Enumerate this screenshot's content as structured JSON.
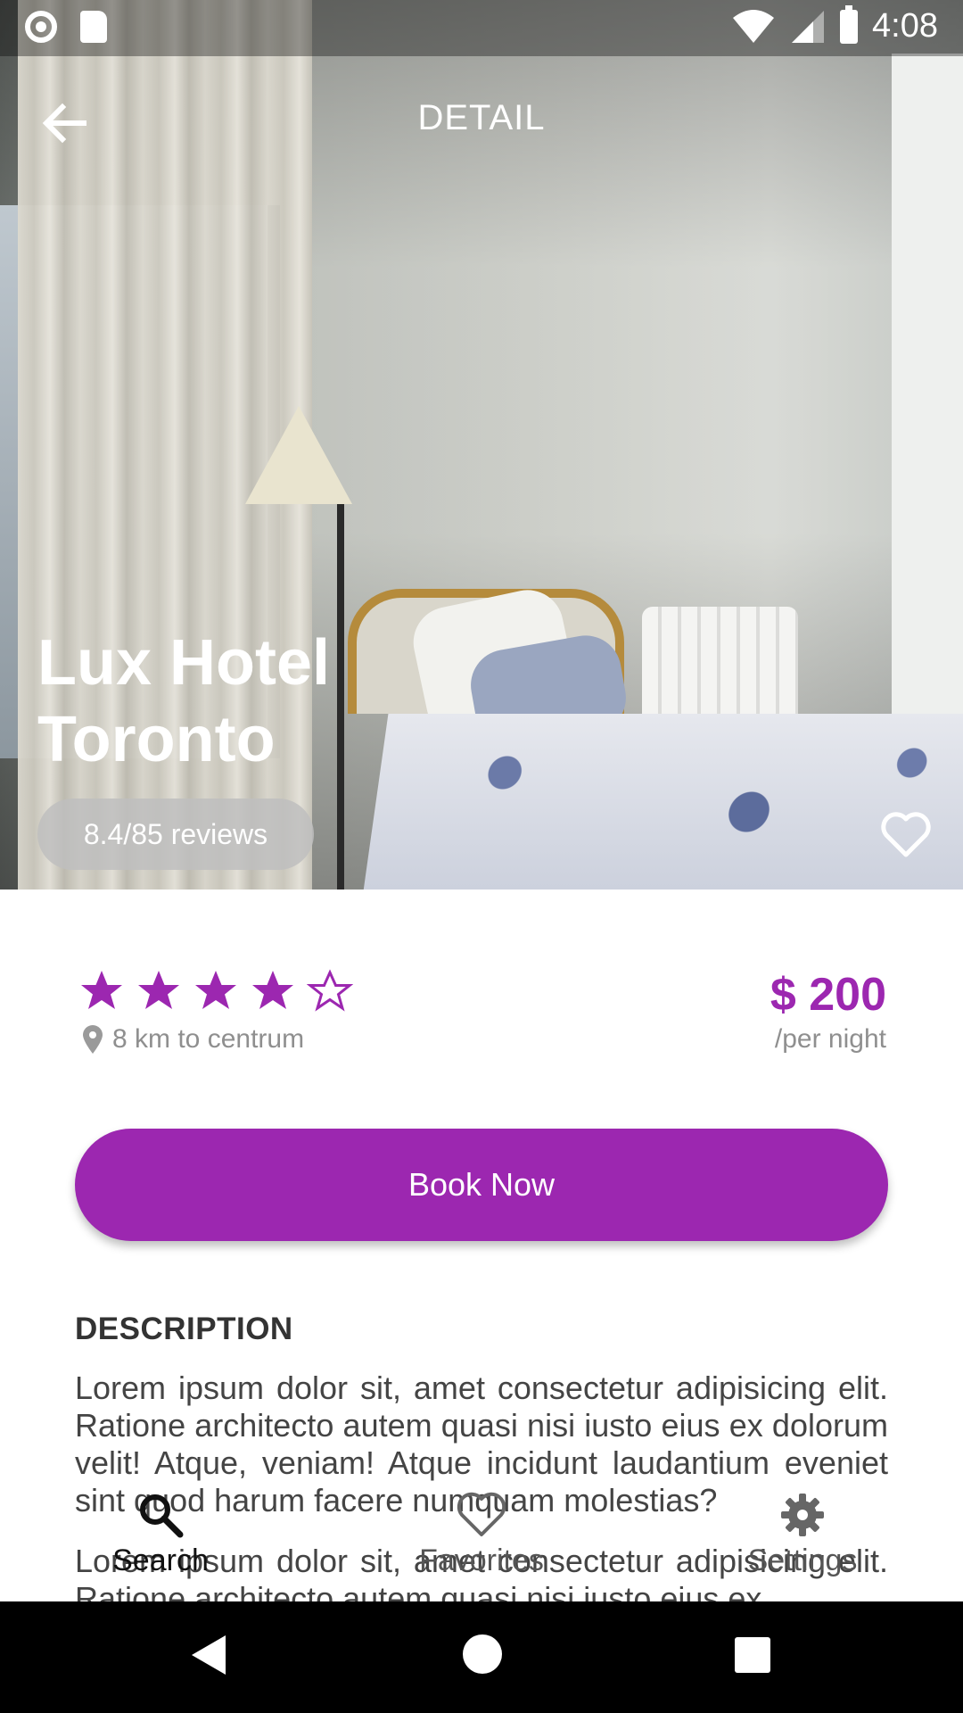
{
  "status_bar": {
    "time": "4:08"
  },
  "header": {
    "title": "DETAIL"
  },
  "hotel": {
    "name_line1": "Lux Hotel",
    "name_line2": "Toronto",
    "reviews": "8.4/85 reviews",
    "rating_stars": 4,
    "max_stars": 5,
    "distance": "8 km to centrum",
    "price": "$ 200",
    "price_unit": "/per night"
  },
  "actions": {
    "book_label": "Book Now"
  },
  "description": {
    "title": "DESCRIPTION",
    "paragraph1": "Lorem ipsum dolor sit, amet consectetur adipisicing elit. Ratione architecto autem quasi nisi iusto eius ex dolorum velit! Atque, veniam! Atque incidunt laudantium eveniet sint quod harum facere numquam molestias?",
    "paragraph2": "Lorem ipsum dolor sit, amet consectetur adipisicing elit. Ratione architecto autem quasi nisi iusto eius ex"
  },
  "bottom_nav": {
    "items": [
      {
        "label": "Search",
        "icon": "search-icon",
        "active": true
      },
      {
        "label": "Favorites",
        "icon": "heart-icon",
        "active": false
      },
      {
        "label": "Settings",
        "icon": "gear-icon",
        "active": false
      }
    ]
  },
  "colors": {
    "accent": "#9c27b0",
    "muted": "#8f8f8f"
  }
}
